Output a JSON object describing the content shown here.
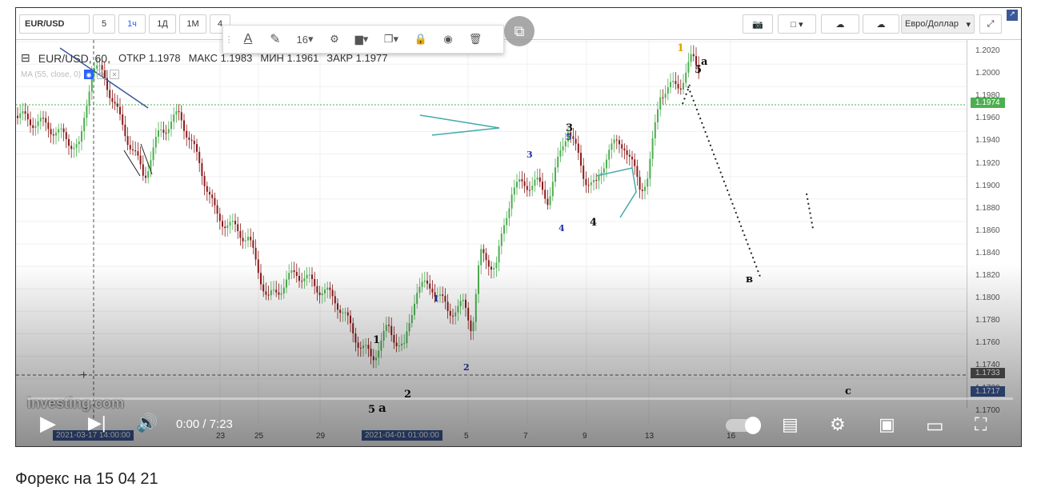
{
  "toolbar": {
    "symbol": "EUR/USD",
    "intervals": [
      "5",
      "1ч",
      "1Д",
      "1М",
      "4"
    ],
    "active_interval": "1ч",
    "currency_select": "Евро/Доллар",
    "draw_font_size": "16"
  },
  "legend": {
    "symbol": "EUR/USD, 60,",
    "open": "ОТКР 1.1978",
    "high": "МАКС 1.1983",
    "low": "МИН 1.1961",
    "close": "ЗАКР 1.1977",
    "ma": "MA (55, close, 0)"
  },
  "yaxis": {
    "ticks": [
      "1.2020",
      "1.2000",
      "1.1980",
      "1.1960",
      "1.1940",
      "1.1920",
      "1.1900",
      "1.1880",
      "1.1860",
      "1.1840",
      "1.1820",
      "1.1800",
      "1.1780",
      "1.1760",
      "1.1740",
      "1.1720",
      "1.1700"
    ],
    "price_label": "1.1974",
    "crosshair_label": "1.1733",
    "last_label": "1.1717"
  },
  "xaxis": {
    "ticks": [
      "23",
      "25",
      "29",
      "5",
      "7",
      "9",
      "13",
      "16"
    ],
    "crosshair_date": "2021-03-17 14:00:00",
    "highlight_date": "2021-04-01 01:00:00"
  },
  "waves": {
    "w1_orange": "1",
    "a_top": "a",
    "five_top": "5",
    "three_blk": "3",
    "five_blue": "5",
    "three_blue": "3",
    "four_blue": "4",
    "four_blk": "4",
    "one_blue": "1",
    "two_blue": "2",
    "one_blk": "1",
    "two_blk": "2",
    "five_bot": "5",
    "a_bot": "a",
    "b": "в",
    "c": "c"
  },
  "watermark": "Investing.com",
  "player": {
    "time": "0:00 / 7:23"
  },
  "caption": "Форекс на 15 04 21",
  "colors": {
    "accent": "#2962ff",
    "candle_up": "#4caf50",
    "candle_down": "#8b1a1a",
    "green_line": "#4caf50",
    "price_label_bg": "#4caf50",
    "axis_label_bg": "#3b5998"
  }
}
